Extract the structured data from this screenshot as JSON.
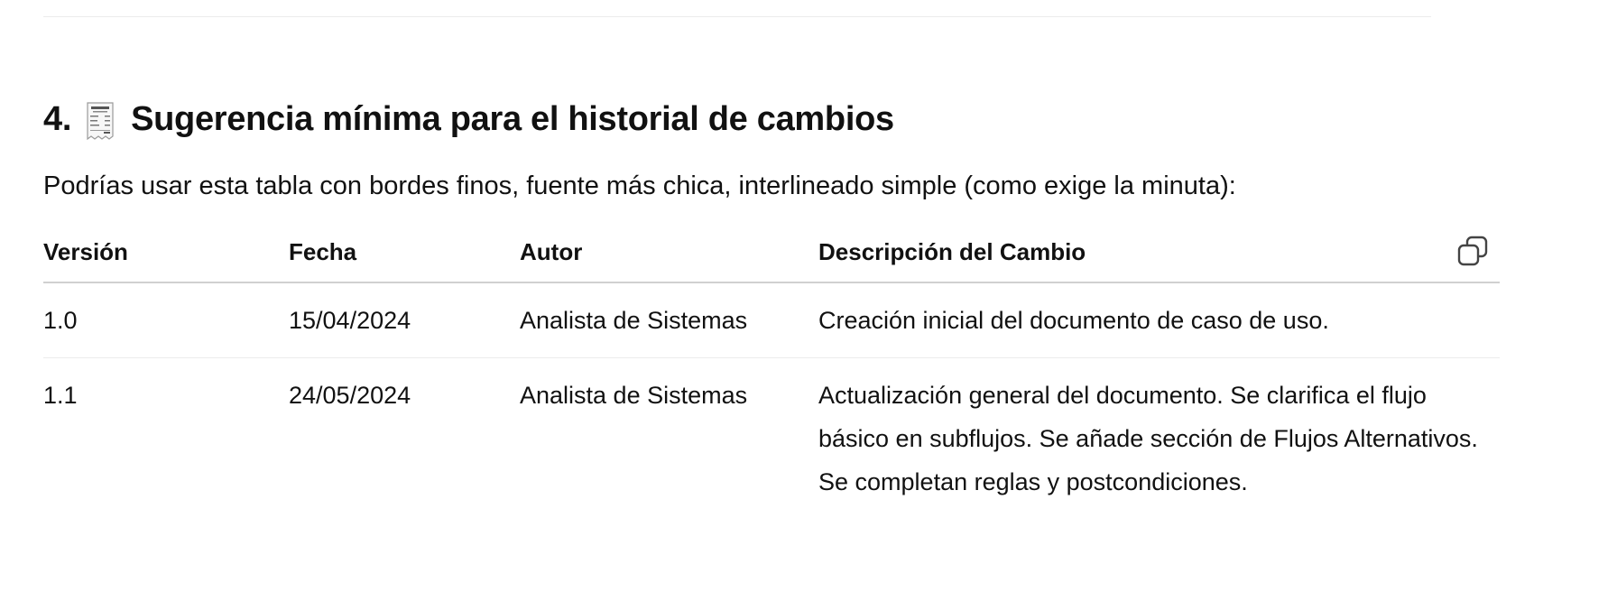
{
  "section": {
    "number": "4.",
    "icon": "receipt-icon",
    "title": "Sugerencia mínima para el historial de cambios",
    "intro": "Podrías usar esta tabla con bordes finos, fuente más chica, interlineado simple (como exige la minuta):"
  },
  "table": {
    "headers": [
      "Versión",
      "Fecha",
      "Autor",
      "Descripción del Cambio"
    ],
    "rows": [
      [
        "1.0",
        "15/04/2024",
        "Analista de Sistemas",
        "Creación inicial del documento de caso de uso."
      ],
      [
        "1.1",
        "24/05/2024",
        "Analista de Sistemas",
        "Actualización general del documento. Se clarifica el flujo básico en subflujos. Se añade sección de Flujos Alternativos. Se completan reglas y postcondiciones."
      ]
    ],
    "copy_icon": "copy-icon"
  }
}
